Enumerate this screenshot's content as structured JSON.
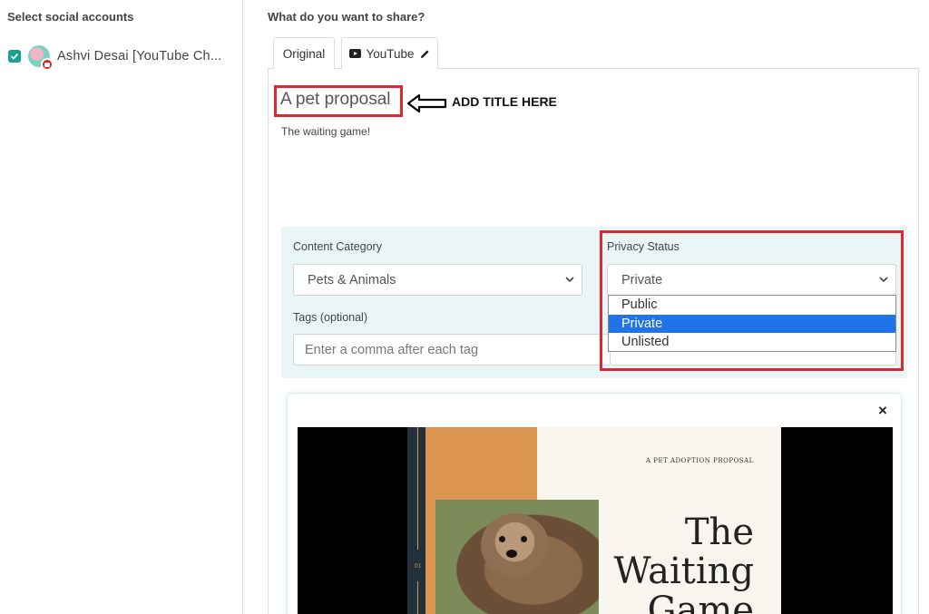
{
  "left": {
    "title": "Select social accounts",
    "account_name": "Ashvi Desai [YouTube Ch..."
  },
  "share": {
    "title": "What do you want to share?",
    "tabs": [
      {
        "label": "Original"
      },
      {
        "label": "YouTube"
      }
    ],
    "post_title": "A pet proposal",
    "annotation": "ADD TITLE HERE",
    "description": "The waiting game!"
  },
  "settings": {
    "content_category_label": "Content Category",
    "content_category_value": "Pets & Animals",
    "privacy_label": "Privacy Status",
    "privacy_value": "Private",
    "privacy_options": [
      "Public",
      "Private",
      "Unlisted"
    ],
    "tags_label": "Tags (optional)",
    "tags_placeholder": "Enter a comma after each tag"
  },
  "media": {
    "close_glyph": "×",
    "slide_subtitle": "A PET ADOPTION PROPOSAL",
    "slide_title_1": "The",
    "slide_title_2": "Waiting",
    "slide_title_3": "Game",
    "slide_number": "01"
  },
  "colors": {
    "accent": "#1a9f93",
    "highlight": "#e0272f",
    "selected_option": "#1e74e8",
    "panel_bg": "#eaf6f5"
  }
}
